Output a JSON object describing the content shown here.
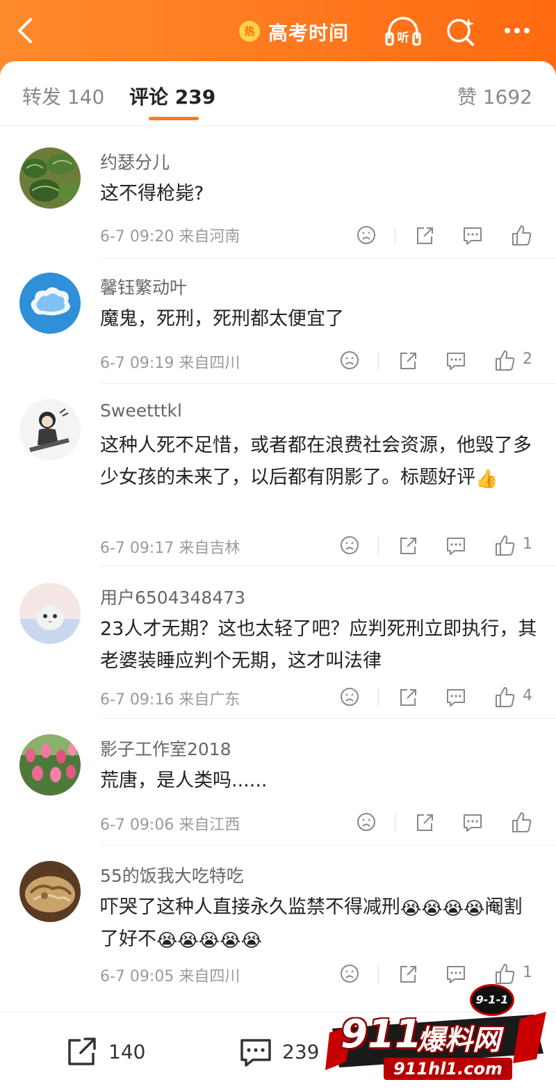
{
  "header": {
    "hot_badge": "热",
    "topic_title": "高考时间",
    "listen_label": "听"
  },
  "tabs": {
    "repost_label": "转发",
    "repost_count": "140",
    "comment_label": "评论",
    "comment_count": "239",
    "like_label": "赞",
    "like_count": "1692"
  },
  "comments": [
    {
      "user": "约瑟分儿",
      "text": "这不得枪毙?",
      "time": "6-7 09:20",
      "location": "来自河南",
      "likes": ""
    },
    {
      "user": "馨钰繁动叶",
      "text": "魔鬼，死刑，死刑都太便宜了",
      "time": "6-7 09:19",
      "location": "来自四川",
      "likes": "2"
    },
    {
      "user": "Sweetttkl",
      "text": "这种人死不足惜，或者都在浪费社会资源，他毁了多少女孩的未来了，以后都有阴影了。标题好评",
      "emoji": "👍",
      "time": "6-7 09:17",
      "location": "来自吉林",
      "likes": "1"
    },
    {
      "user": "用户6504348473",
      "text": "23人才无期？这也太轻了吧？应判死刑立即执行，其老婆装睡应判个无期，这才叫法律",
      "time": "6-7 09:16",
      "location": "来自广东",
      "likes": "4"
    },
    {
      "user": "影子工作室2018",
      "text": "荒唐，是人类吗......",
      "time": "6-7 09:06",
      "location": "来自江西",
      "likes": ""
    },
    {
      "user": "55的饭我大吃特吃",
      "text_part1": "吓哭了这种人直接永久监禁不得减刑",
      "text_part2": "阉割了好不",
      "emoji": "😭",
      "time": "6-7 09:05",
      "location": "来自四川",
      "likes": "1"
    }
  ],
  "bottombar": {
    "repost_count": "140",
    "comment_count": "239"
  },
  "watermark": {
    "number": "911",
    "name": "爆料网",
    "url": "911hl1.com",
    "badge": "9-1-1"
  },
  "colors": {
    "accent": "#ff7a1f",
    "header_gradient_start": "#ff8a2b",
    "header_gradient_end": "#ff6a10"
  }
}
